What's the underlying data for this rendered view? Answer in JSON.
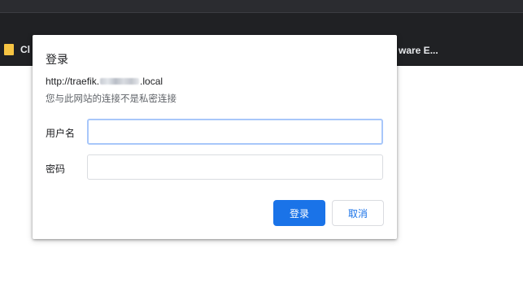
{
  "bookmarks_bar": {
    "left_item_label": "Cl",
    "right_item_label": "ware E..."
  },
  "dialog": {
    "title": "登录",
    "url_prefix": "http://traefik.",
    "url_suffix": ".local",
    "connection_warning": "您与此网站的连接不是私密连接",
    "username_label": "用户名",
    "username_value": "",
    "password_label": "密码",
    "password_value": "",
    "login_button_label": "登录",
    "cancel_button_label": "取消"
  },
  "icons": {
    "bookmark_folder": "folder-icon"
  },
  "colors": {
    "primary_button": "#1a73e8",
    "focused_input_border": "#a8c7fa",
    "chrome_background": "#202124",
    "bookmark_folder": "#f6c443"
  }
}
